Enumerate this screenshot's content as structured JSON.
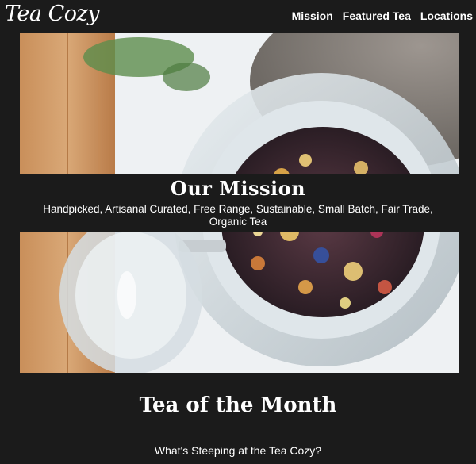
{
  "brand": {
    "logo_text": "Tea Cozy"
  },
  "nav": {
    "items": [
      {
        "label": "Mission"
      },
      {
        "label": "Featured Tea"
      },
      {
        "label": "Locations"
      }
    ]
  },
  "hero": {
    "image_name": "loose-leaf-tea-jar-image"
  },
  "mission": {
    "title": "Our Mission",
    "text": "Handpicked, Artisanal Curated, Free Range, Sustainable, Small Batch, Fair Trade, Organic Tea"
  },
  "tea_of_month": {
    "title": "Tea of the Month",
    "subtitle": "What's Steeping at the Tea Cozy?"
  },
  "colors": {
    "background": "#1b1b1b",
    "text": "#ffffff"
  }
}
